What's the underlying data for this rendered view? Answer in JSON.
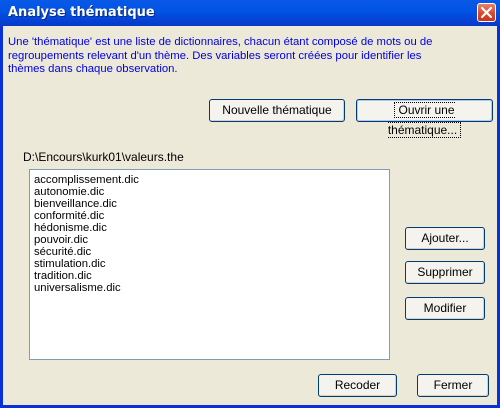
{
  "window": {
    "title": "Analyse thématique"
  },
  "description": {
    "line1": "Une 'thématique' est une liste de dictionnaires, chacun étant composé de mots ou de",
    "line2": "regroupements relevant d'un thème. Des variables seront créées pour identifier les",
    "line3": "thèmes dans chaque observation."
  },
  "buttons": {
    "new_theme": "Nouvelle thématique",
    "open_theme": "Ouvrir une thématique...",
    "add": "Ajouter...",
    "delete": "Supprimer",
    "modify": "Modifier",
    "recode": "Recoder",
    "close": "Fermer"
  },
  "file_path": "D:\\Encours\\kurk01\\valeurs.the",
  "dictionaries": [
    "accomplissement.dic",
    "autonomie.dic",
    "bienveillance.dic",
    "conformité.dic",
    "hédonisme.dic",
    "pouvoir.dic",
    "sécurité.dic",
    "stimulation.dic",
    "tradition.dic",
    "universalisme.dic"
  ],
  "icons": {
    "close": "close-icon"
  },
  "colors": {
    "title_bar": "#0055E5",
    "description_text": "#0000E0",
    "close_button": "#D9452A",
    "dialog_background": "#ECE9D8"
  }
}
